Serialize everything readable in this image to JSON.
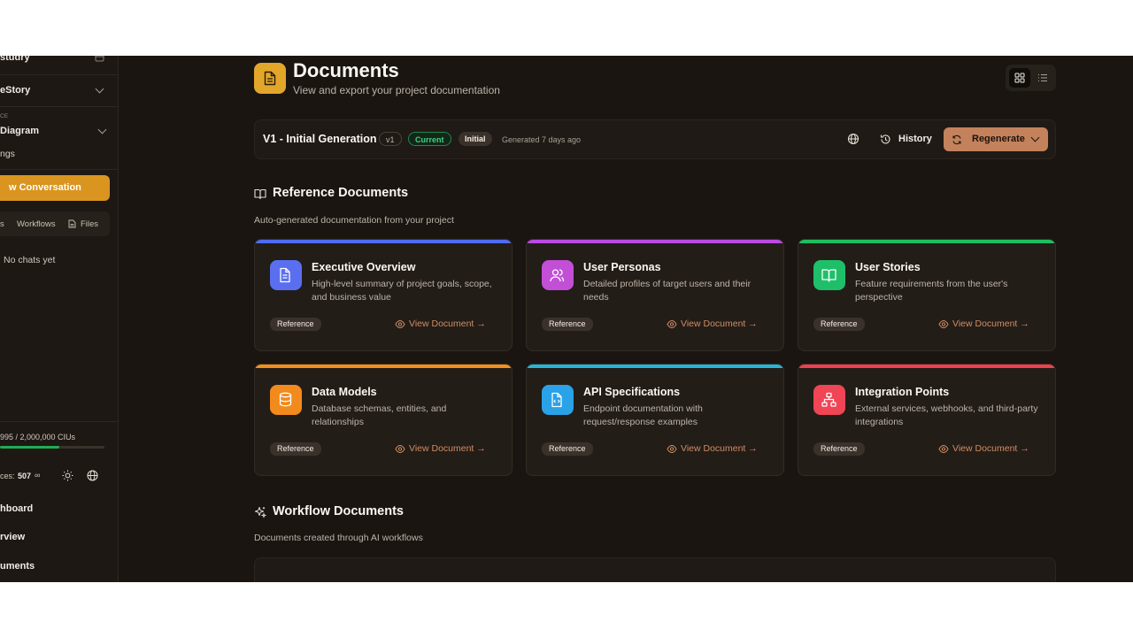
{
  "sidebar": {
    "top_item": "studry",
    "project_name": "eStory",
    "section_label": "CE",
    "diagram_label": "Diagram",
    "settings_label": "ngs",
    "new_conversation": "w Conversation",
    "tabs": [
      "s",
      "Workflows",
      "Files"
    ],
    "empty_state": "No chats yet",
    "usage_text": "995 / 2,000,000 CIUs",
    "usage_fraction": 0.57,
    "sources_label": "ces:",
    "sources_count": "507",
    "sources_infinity": "∞",
    "nav": [
      "hboard",
      "rview",
      "uments"
    ]
  },
  "header": {
    "title": "Documents",
    "subtitle": "View and export your project documentation"
  },
  "version_bar": {
    "title": "V1 - Initial Generation",
    "badge_version": "v1",
    "badge_current": "Current",
    "badge_initial": "Initial",
    "generated": "Generated 7 days ago",
    "history": "History",
    "regenerate": "Regenerate"
  },
  "reference_section": {
    "title": "Reference Documents",
    "subtitle": "Auto-generated documentation from your project"
  },
  "cards": [
    {
      "title": "Executive Overview",
      "description": "High-level summary of project goals, scope, and business value",
      "tag": "Reference",
      "action": "View Document →",
      "icon": "file-text-icon",
      "color": "#5a6ff0",
      "stripe": "#4f6cf2"
    },
    {
      "title": "User Personas",
      "description": "Detailed profiles of target users and their needs",
      "tag": "Reference",
      "action": "View Document →",
      "icon": "users-icon",
      "color": "#c24fd6",
      "stripe": "#b84be0"
    },
    {
      "title": "User Stories",
      "description": "Feature requirements from the user's perspective",
      "tag": "Reference",
      "action": "View Document →",
      "icon": "book-open-icon",
      "color": "#1fbf6a",
      "stripe": "#1fbf5e"
    },
    {
      "title": "Data Models",
      "description": "Database schemas, entities, and relationships",
      "tag": "Reference",
      "action": "View Document →",
      "icon": "database-icon",
      "color": "#f28a1d",
      "stripe": "#f2901d"
    },
    {
      "title": "API Specifications",
      "description": "Endpoint documentation with request/response examples",
      "tag": "Reference",
      "action": "View Document →",
      "icon": "file-code-icon",
      "color": "#2aa2e8",
      "stripe": "#25b6d8"
    },
    {
      "title": "Integration Points",
      "description": "External services, webhooks, and third-party integrations",
      "tag": "Reference",
      "action": "View Document →",
      "icon": "network-icon",
      "color": "#ef4555",
      "stripe": "#ef4050"
    }
  ],
  "workflow_section": {
    "title": "Workflow Documents",
    "subtitle": "Documents created through AI workflows"
  }
}
